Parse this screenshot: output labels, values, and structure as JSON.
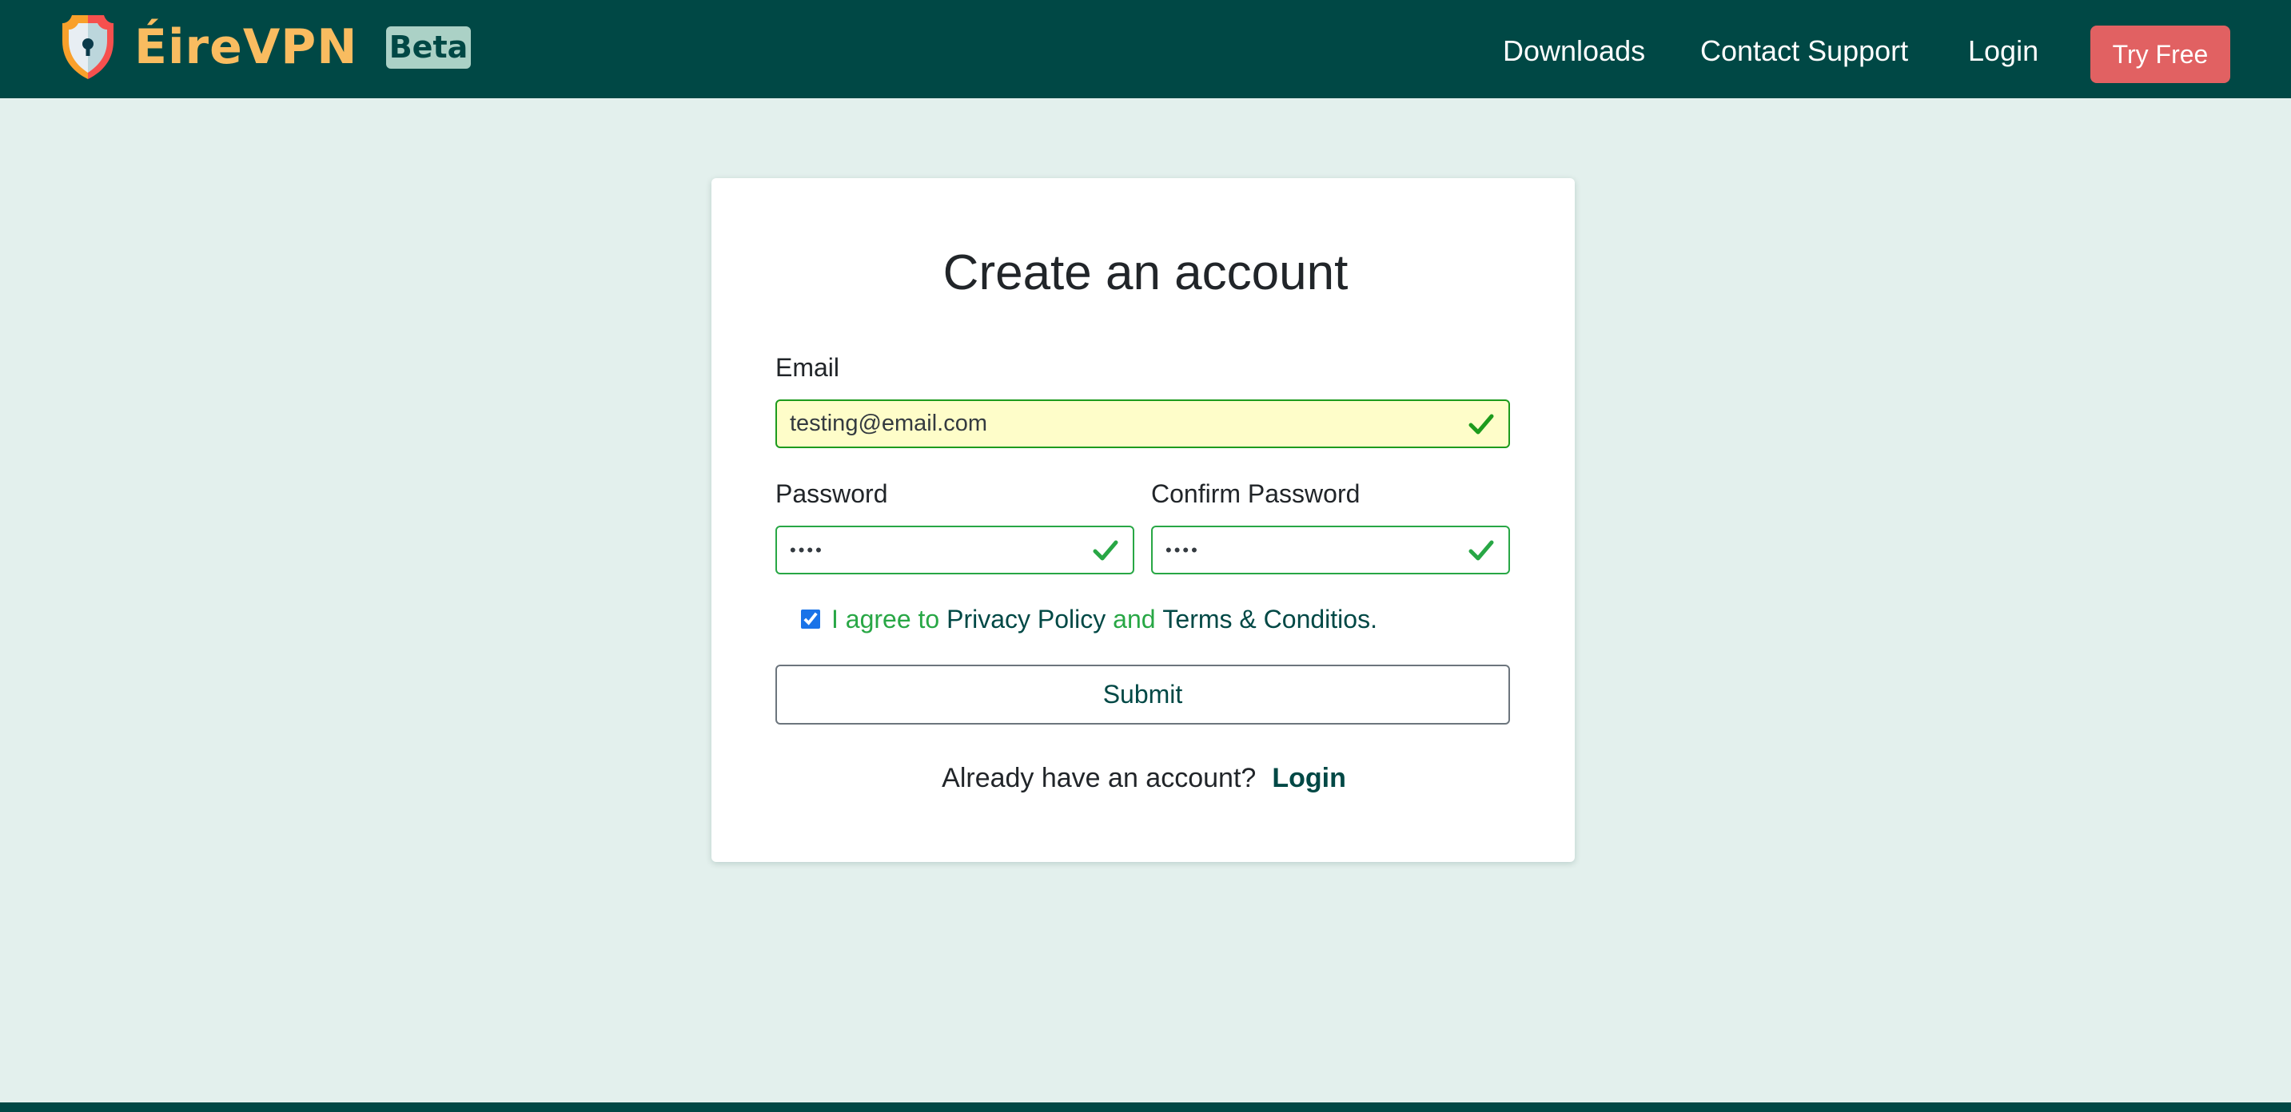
{
  "header": {
    "brand_name": "ÉireVPN",
    "badge": "Beta",
    "nav": {
      "downloads": "Downloads",
      "contact_support": "Contact Support",
      "login": "Login"
    },
    "cta": "Try Free"
  },
  "form": {
    "title": "Create an account",
    "email": {
      "label": "Email",
      "value": "testing@email.com",
      "status": "valid"
    },
    "password": {
      "label": "Password",
      "value": "••••",
      "status": "valid"
    },
    "confirm_password": {
      "label": "Confirm Password",
      "value": "••••",
      "status": "valid"
    },
    "agree": {
      "checked": true,
      "prefix": "I agree to ",
      "privacy_link": "Privacy Policy",
      "conjunction": " and ",
      "terms_link": "Terms & Conditios."
    },
    "submit_label": "Submit",
    "already_text": "Already have an account?",
    "login_link": "Login"
  },
  "colors": {
    "primary": "#004845",
    "accent": "#f9bc60",
    "cta": "#e16162",
    "badge_bg": "#abd1c6",
    "background": "#e3f0ed",
    "valid": "#28a745"
  }
}
